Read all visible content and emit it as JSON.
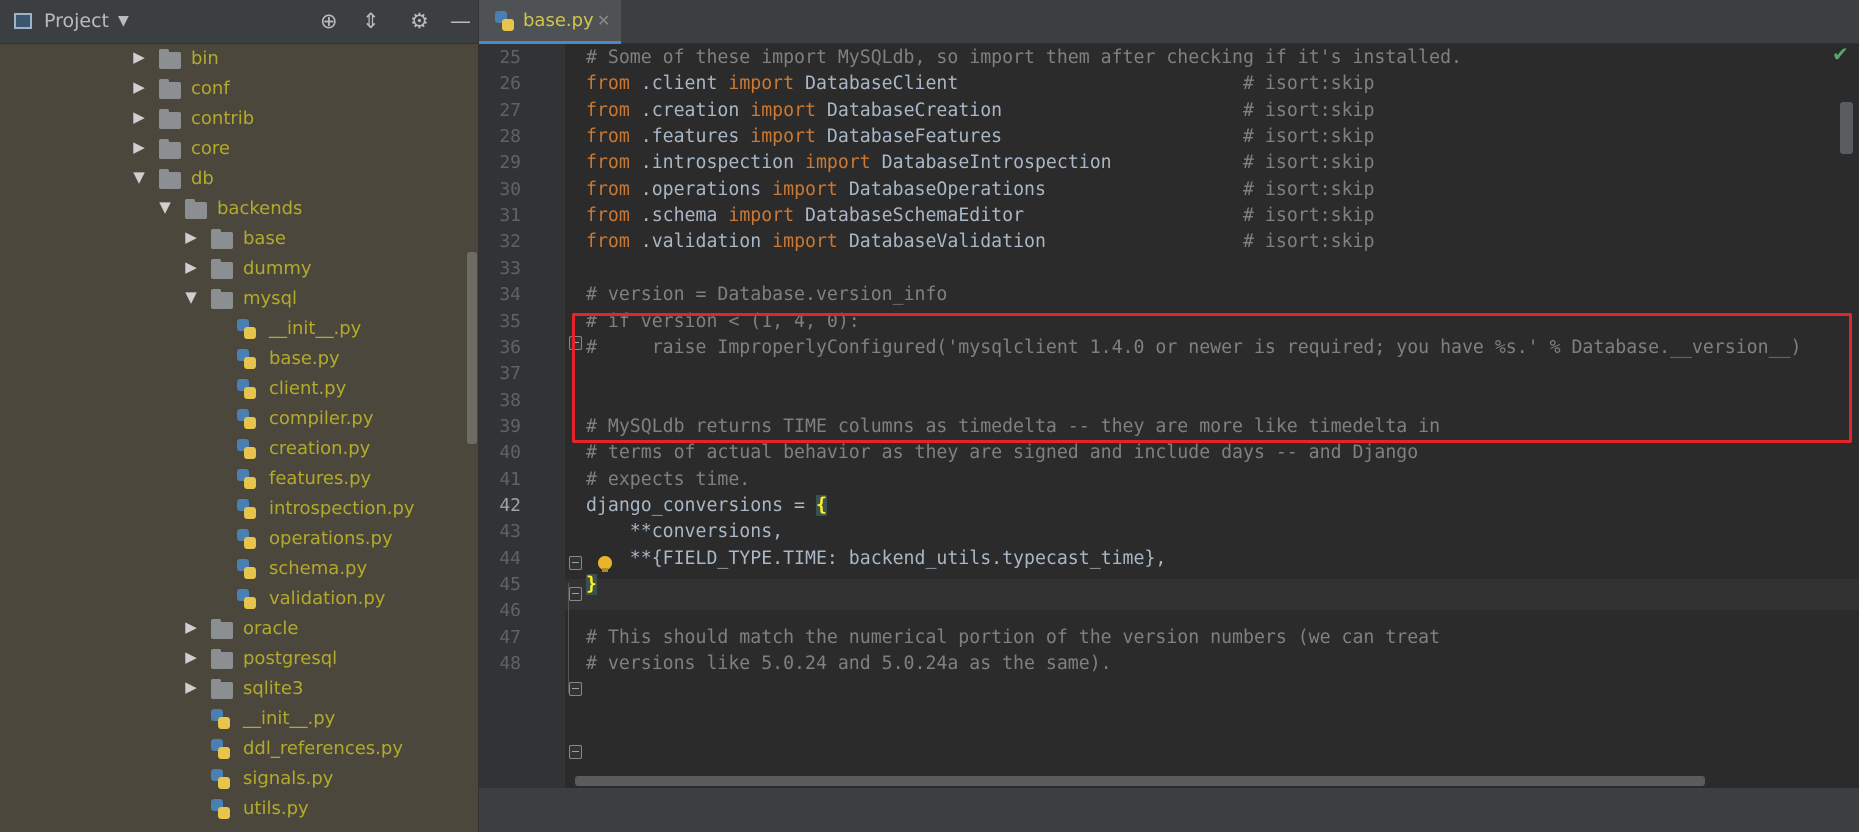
{
  "project_panel": {
    "title": "Project",
    "icons": [
      "project-window-icon",
      "locate-icon",
      "collapse-all-icon",
      "gear-icon",
      "hide-icon"
    ],
    "tree": [
      {
        "label": "bin",
        "type": "folder",
        "expanded": false,
        "depth": 0
      },
      {
        "label": "conf",
        "type": "folder",
        "expanded": false,
        "depth": 0
      },
      {
        "label": "contrib",
        "type": "folder",
        "expanded": false,
        "depth": 0
      },
      {
        "label": "core",
        "type": "folder",
        "expanded": false,
        "depth": 0
      },
      {
        "label": "db",
        "type": "folder",
        "expanded": true,
        "depth": 0
      },
      {
        "label": "backends",
        "type": "folder",
        "expanded": true,
        "depth": 1
      },
      {
        "label": "base",
        "type": "folder",
        "expanded": false,
        "depth": 2
      },
      {
        "label": "dummy",
        "type": "folder",
        "expanded": false,
        "depth": 2
      },
      {
        "label": "mysql",
        "type": "folder",
        "expanded": true,
        "depth": 2
      },
      {
        "label": "__init__.py",
        "type": "file",
        "depth": 3
      },
      {
        "label": "base.py",
        "type": "file",
        "depth": 3
      },
      {
        "label": "client.py",
        "type": "file",
        "depth": 3
      },
      {
        "label": "compiler.py",
        "type": "file",
        "depth": 3
      },
      {
        "label": "creation.py",
        "type": "file",
        "depth": 3
      },
      {
        "label": "features.py",
        "type": "file",
        "depth": 3
      },
      {
        "label": "introspection.py",
        "type": "file",
        "depth": 3
      },
      {
        "label": "operations.py",
        "type": "file",
        "depth": 3
      },
      {
        "label": "schema.py",
        "type": "file",
        "depth": 3
      },
      {
        "label": "validation.py",
        "type": "file",
        "depth": 3
      },
      {
        "label": "oracle",
        "type": "folder",
        "expanded": false,
        "depth": 2
      },
      {
        "label": "postgresql",
        "type": "folder",
        "expanded": false,
        "depth": 2
      },
      {
        "label": "sqlite3",
        "type": "folder",
        "expanded": false,
        "depth": 2
      },
      {
        "label": "__init__.py",
        "type": "file",
        "depth": 2
      },
      {
        "label": "ddl_references.py",
        "type": "file",
        "depth": 2
      },
      {
        "label": "signals.py",
        "type": "file",
        "depth": 2
      },
      {
        "label": "utils.py",
        "type": "file",
        "depth": 2
      }
    ]
  },
  "editor": {
    "tab": {
      "label": "base.py",
      "close": "✕"
    },
    "current_line": 42,
    "status_icon": "checkmark-icon",
    "lines": [
      {
        "n": 25,
        "t": [
          [
            "cm",
            "# Some of these import MySQLdb, so import them after checking if it's installed."
          ]
        ]
      },
      {
        "n": 26,
        "t": [
          [
            "kw",
            "from"
          ],
          [
            "",
            " .client "
          ],
          [
            "kw",
            "import"
          ],
          [
            "",
            " DatabaseClient                          "
          ],
          [
            "cm",
            "# isort:skip"
          ]
        ]
      },
      {
        "n": 27,
        "t": [
          [
            "kw",
            "from"
          ],
          [
            "",
            " .creation "
          ],
          [
            "kw",
            "import"
          ],
          [
            "",
            " DatabaseCreation                      "
          ],
          [
            "cm",
            "# isort:skip"
          ]
        ]
      },
      {
        "n": 28,
        "t": [
          [
            "kw",
            "from"
          ],
          [
            "",
            " .features "
          ],
          [
            "kw",
            "import"
          ],
          [
            "",
            " DatabaseFeatures                      "
          ],
          [
            "cm",
            "# isort:skip"
          ]
        ]
      },
      {
        "n": 29,
        "t": [
          [
            "kw",
            "from"
          ],
          [
            "",
            " .introspection "
          ],
          [
            "kw",
            "import"
          ],
          [
            "",
            " DatabaseIntrospection            "
          ],
          [
            "cm",
            "# isort:skip"
          ]
        ]
      },
      {
        "n": 30,
        "t": [
          [
            "kw",
            "from"
          ],
          [
            "",
            " .operations "
          ],
          [
            "kw",
            "import"
          ],
          [
            "",
            " DatabaseOperations                  "
          ],
          [
            "cm",
            "# isort:skip"
          ]
        ]
      },
      {
        "n": 31,
        "t": [
          [
            "kw",
            "from"
          ],
          [
            "",
            " .schema "
          ],
          [
            "kw",
            "import"
          ],
          [
            "",
            " DatabaseSchemaEditor                    "
          ],
          [
            "cm",
            "# isort:skip"
          ]
        ]
      },
      {
        "n": 32,
        "t": [
          [
            "kw",
            "from"
          ],
          [
            "",
            " .validation "
          ],
          [
            "kw",
            "import"
          ],
          [
            "",
            " DatabaseValidation                  "
          ],
          [
            "cm",
            "# isort:skip"
          ]
        ]
      },
      {
        "n": 33,
        "t": []
      },
      {
        "n": 34,
        "t": [
          [
            "cm",
            "# version = Database.version_info"
          ]
        ]
      },
      {
        "n": 35,
        "t": [
          [
            "cm",
            "# if version < (1, 4, 0):"
          ]
        ]
      },
      {
        "n": 36,
        "t": [
          [
            "cm",
            "#     raise ImproperlyConfigured('mysqlclient 1.4.0 or newer is required; you have %s.' % Database.__version__)"
          ]
        ]
      },
      {
        "n": 37,
        "t": []
      },
      {
        "n": 38,
        "t": []
      },
      {
        "n": 39,
        "t": [
          [
            "cm",
            "# MySQLdb returns TIME columns as timedelta -- they are more like timedelta in"
          ]
        ]
      },
      {
        "n": 40,
        "t": [
          [
            "cm",
            "# terms of actual behavior as they are signed and include days -- and Django"
          ]
        ]
      },
      {
        "n": 41,
        "t": [
          [
            "cm",
            "# expects time."
          ]
        ]
      },
      {
        "n": 42,
        "t": [
          [
            "",
            "django_conversions = "
          ],
          [
            "bracket-hl",
            "{"
          ]
        ]
      },
      {
        "n": 43,
        "t": [
          [
            "",
            "    **conversions,"
          ]
        ]
      },
      {
        "n": 44,
        "t": [
          [
            "",
            "    **{FIELD_TYPE.TIME: backend_utils.typecast_time},"
          ]
        ]
      },
      {
        "n": 45,
        "t": [
          [
            "bracket-hl",
            "}"
          ]
        ]
      },
      {
        "n": 46,
        "t": []
      },
      {
        "n": 47,
        "t": [
          [
            "cm",
            "# This should match the numerical portion of the version numbers (we can treat"
          ]
        ]
      },
      {
        "n": 48,
        "t": [
          [
            "cm",
            "# versions like 5.0.24 and 5.0.24a as the same)."
          ]
        ]
      }
    ]
  }
}
